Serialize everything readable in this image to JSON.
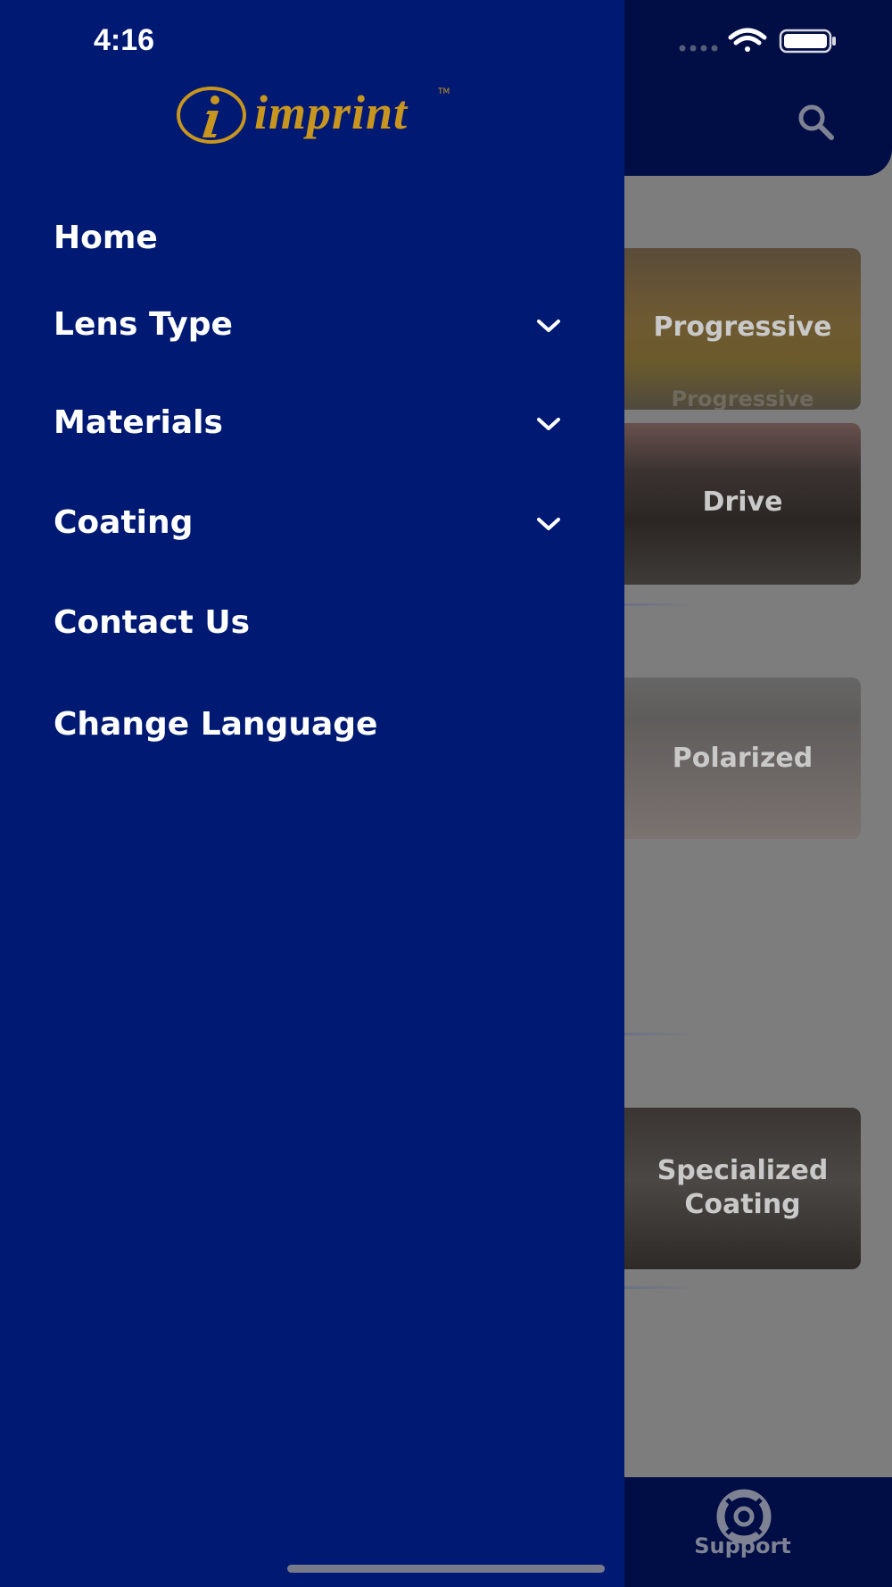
{
  "status_bar": {
    "time": "4:16"
  },
  "brand": {
    "logo_text": "imprint",
    "logo_initial": "i",
    "trademark": "TM"
  },
  "drawer": {
    "items": [
      {
        "label": "Home",
        "expandable": false
      },
      {
        "label": "Lens Type",
        "expandable": true
      },
      {
        "label": "Materials",
        "expandable": true
      },
      {
        "label": "Coating",
        "expandable": true
      },
      {
        "label": "Contact Us",
        "expandable": false
      },
      {
        "label": "Change Language",
        "expandable": false
      }
    ]
  },
  "background": {
    "cards": [
      {
        "title": "Progressive",
        "watermark": "Progressive"
      },
      {
        "title": "Drive"
      },
      {
        "title": "Polarized"
      },
      {
        "title_line1": "Specialized",
        "title_line2": "Coating"
      }
    ],
    "bottom_nav": {
      "support_label": "Support"
    }
  },
  "colors": {
    "drawer_bg": "#001a73",
    "header_bg": "#000e45",
    "logo_gold": "#c8961e",
    "overlay_gray": "#7d7d7d"
  },
  "icons": [
    "search-icon",
    "chevron-down-icon",
    "support-icon",
    "wifi-icon",
    "battery-icon",
    "signal-icon"
  ]
}
